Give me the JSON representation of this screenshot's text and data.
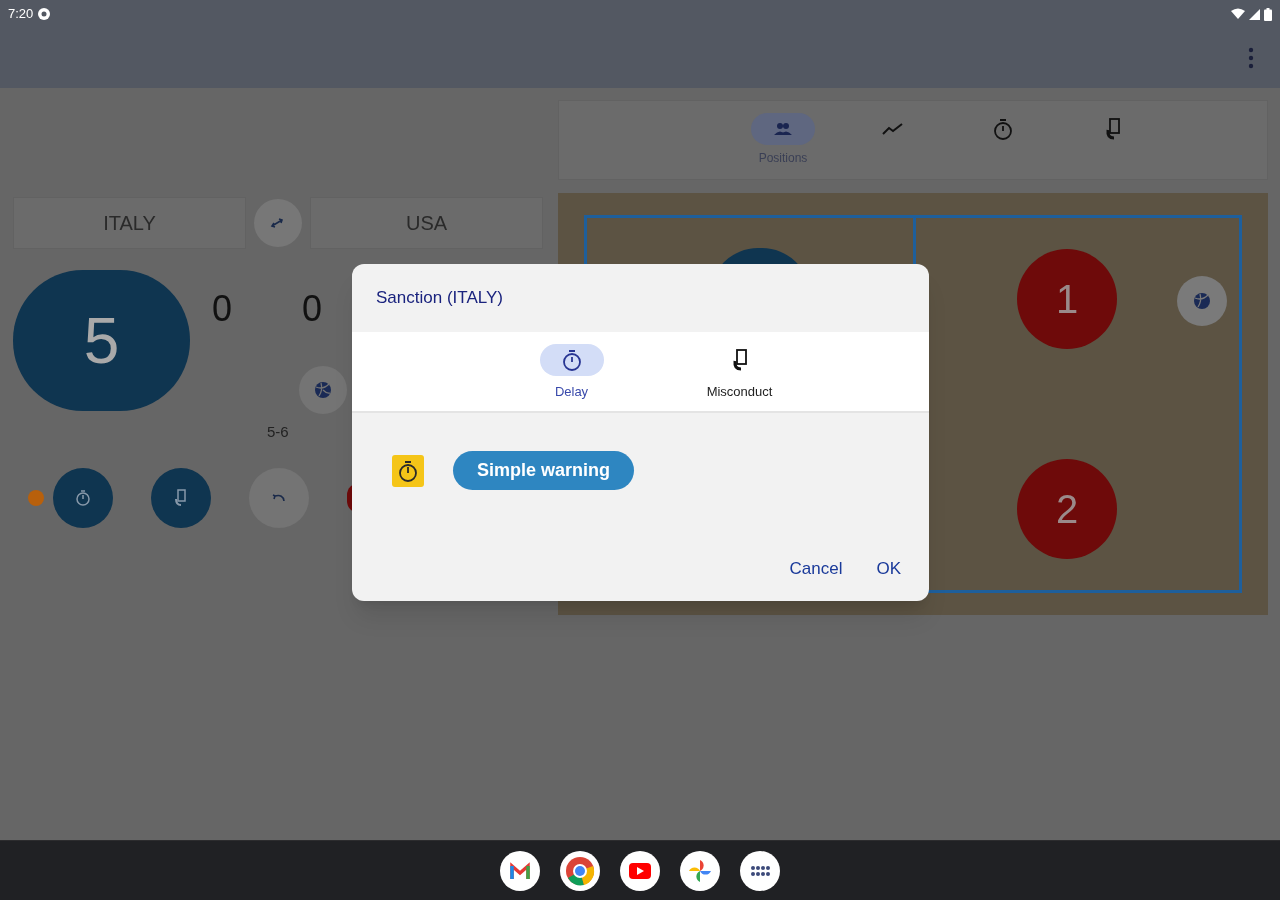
{
  "status_bar": {
    "time": "7:20"
  },
  "teams": [
    {
      "name": "ITALY"
    },
    {
      "name": "USA"
    }
  ],
  "serving_score": "5",
  "set_scores": [
    "0",
    "0"
  ],
  "rally_score": "5-6",
  "nav_tabs": [
    {
      "kind": "positions",
      "label": "Positions",
      "selected": true
    },
    {
      "kind": "chart",
      "selected": false
    },
    {
      "kind": "timer",
      "selected": false
    },
    {
      "kind": "card",
      "selected": false
    }
  ],
  "court": {
    "players": [
      {
        "number": "1"
      },
      {
        "number": "2"
      }
    ]
  },
  "dialog": {
    "title": "Sanction (ITALY)",
    "tabs": [
      {
        "kind": "timer",
        "label": "Delay",
        "selected": true
      },
      {
        "kind": "card",
        "label": "Misconduct",
        "selected": false
      }
    ],
    "option": {
      "label": "Simple warning"
    },
    "buttons": [
      "Cancel",
      "OK"
    ]
  },
  "dock": [
    {
      "kind": "mail"
    },
    {
      "kind": "browser"
    },
    {
      "kind": "video"
    },
    {
      "kind": "photos"
    },
    {
      "kind": "apps"
    }
  ]
}
